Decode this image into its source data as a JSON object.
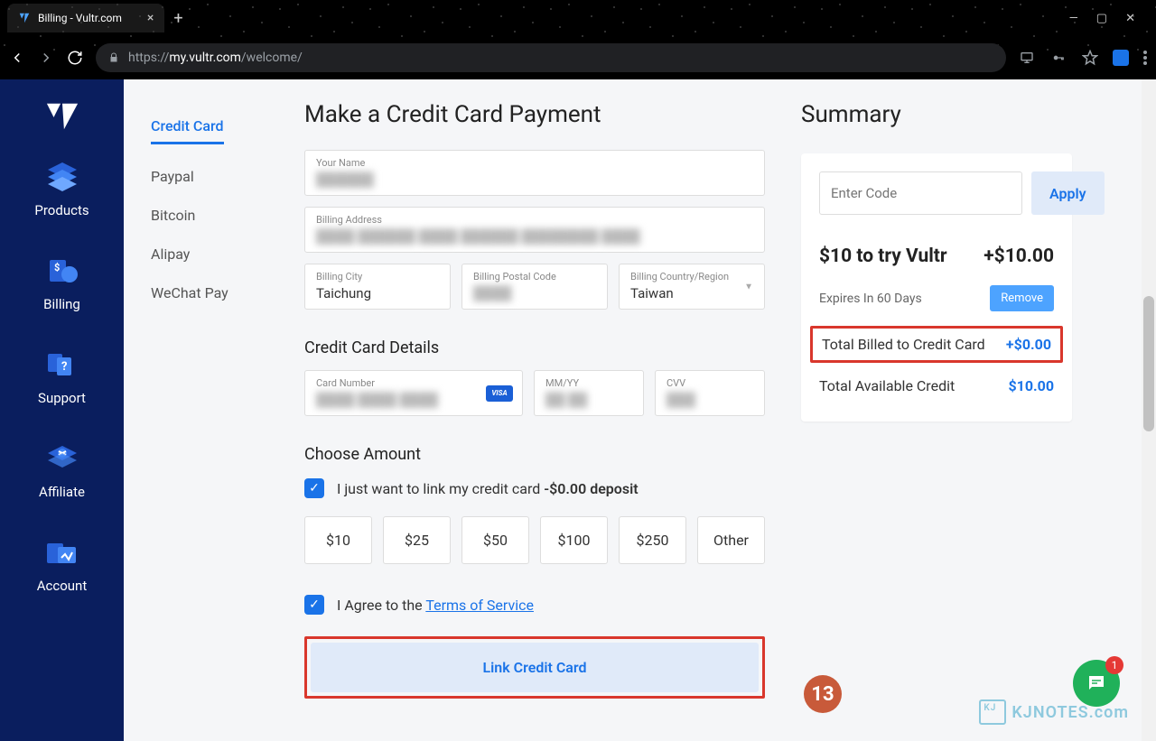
{
  "browser": {
    "tab_title": "Billing - Vultr.com",
    "url_prefix": "https://",
    "url_host": "my.vultr.com",
    "url_path": "/welcome/"
  },
  "sidebar": {
    "items": [
      {
        "label": "Products"
      },
      {
        "label": "Billing"
      },
      {
        "label": "Support"
      },
      {
        "label": "Affiliate"
      },
      {
        "label": "Account"
      }
    ]
  },
  "payment_tabs": [
    {
      "label": "Credit Card",
      "active": true
    },
    {
      "label": "Paypal"
    },
    {
      "label": "Bitcoin"
    },
    {
      "label": "Alipay"
    },
    {
      "label": "WeChat Pay"
    }
  ],
  "form": {
    "heading": "Make a Credit Card Payment",
    "name_label": "Your Name",
    "name_value": "██████",
    "address_label": "Billing Address",
    "address_value": "████ ██████ ████ ██████ ████████ ████",
    "city_label": "Billing City",
    "city_value": "Taichung",
    "postal_label": "Billing Postal Code",
    "postal_value": "████",
    "country_label": "Billing Country/Region",
    "country_value": "Taiwan",
    "cc_heading": "Credit Card Details",
    "card_label": "Card Number",
    "card_value": "████ ████ ████",
    "card_brand": "VISA",
    "exp_label": "MM/YY",
    "exp_value": "██ ██",
    "cvv_label": "CVV",
    "cvv_value": "███",
    "amount_heading": "Choose Amount",
    "link_only_text": "I just want to link my credit card ",
    "link_only_deposit": "-$0.00 deposit",
    "amounts": [
      "$10",
      "$25",
      "$50",
      "$100",
      "$250",
      "Other"
    ],
    "agree_prefix": "I Agree to the ",
    "tos_link": "Terms of Service",
    "submit_label": "Link Credit Card"
  },
  "summary": {
    "heading": "Summary",
    "code_placeholder": "Enter Code",
    "apply_label": "Apply",
    "promo_title": "$10 to try Vultr",
    "promo_value": "+$10.00",
    "expires": "Expires In 60 Days",
    "remove_label": "Remove",
    "billed_label": "Total Billed to Credit Card",
    "billed_value": "+$0.00",
    "avail_label": "Total Available Credit",
    "avail_value": "$10.00"
  },
  "callout": "13",
  "chat_badge": "1",
  "watermark": "KJNOTES.com"
}
